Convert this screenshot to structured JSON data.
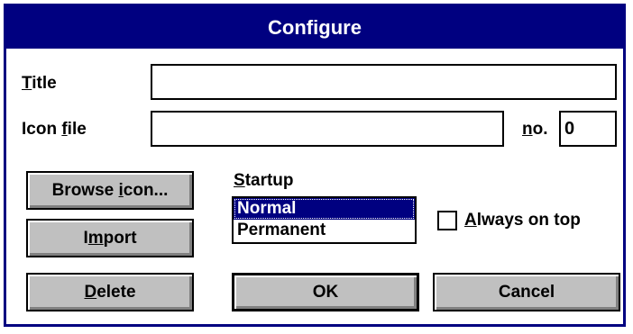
{
  "dialog": {
    "title": "Configure"
  },
  "fields": {
    "title_label_first": "T",
    "title_label_rest": "itle",
    "title_value": "",
    "icon_file_label_pre": "Icon ",
    "icon_file_label_accel": "f",
    "icon_file_label_post": "ile",
    "icon_file_value": "",
    "no_label_accel": "n",
    "no_label_post": "o.",
    "no_value": "0"
  },
  "startup": {
    "label_accel": "S",
    "label_rest": "tartup",
    "options": [
      "Normal",
      "Permanent"
    ],
    "selected": "Normal"
  },
  "checkbox": {
    "label_accel": "A",
    "label_rest": "lways on top",
    "checked": false
  },
  "buttons": {
    "browse_pre": "Browse ",
    "browse_accel": "i",
    "browse_post": "con...",
    "import_pre": "I",
    "import_accel": "m",
    "import_post": "port",
    "delete_accel": "D",
    "delete_post": "elete",
    "ok": "OK",
    "cancel": "Cancel"
  }
}
